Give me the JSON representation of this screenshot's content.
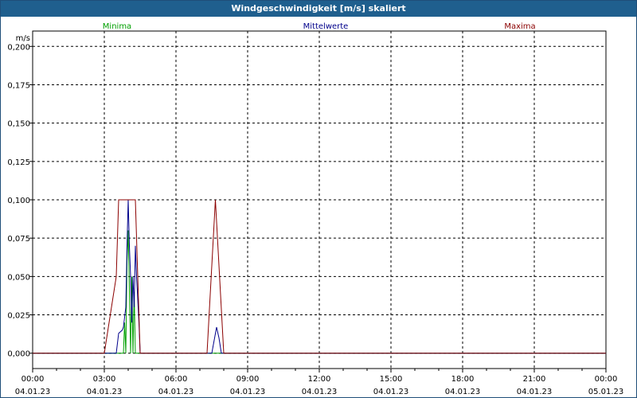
{
  "window": {
    "title": "Windgeschwindigkeit [m/s] skaliert"
  },
  "chart_data": {
    "type": "line",
    "title": "Windgeschwindigkeit [m/s] skaliert",
    "ylabel": "m/s",
    "xlabel": "",
    "ylim": [
      -0.01,
      0.21
    ],
    "xlim": [
      0,
      24
    ],
    "y_ticks": [
      0.0,
      0.025,
      0.05,
      0.075,
      0.1,
      0.125,
      0.15,
      0.175,
      0.2
    ],
    "y_tick_labels": [
      "0,000",
      "0,025",
      "0,050",
      "0,075",
      "0,100",
      "0,125",
      "0,150",
      "0,175",
      "0,200"
    ],
    "x_ticks": [
      0,
      3,
      6,
      9,
      12,
      15,
      18,
      21,
      24
    ],
    "x_tick_labels": [
      {
        "time": "00:00",
        "date": "04.01.23"
      },
      {
        "time": "03:00",
        "date": "04.01.23"
      },
      {
        "time": "06:00",
        "date": "04.01.23"
      },
      {
        "time": "09:00",
        "date": "04.01.23"
      },
      {
        "time": "12:00",
        "date": "04.01.23"
      },
      {
        "time": "15:00",
        "date": "04.01.23"
      },
      {
        "time": "18:00",
        "date": "04.01.23"
      },
      {
        "time": "21:00",
        "date": "04.01.23"
      },
      {
        "time": "00:00",
        "date": "05.01.23"
      }
    ],
    "grid": true,
    "legend_placement": "top",
    "series": [
      {
        "name": "Minima",
        "color": "#00a000",
        "points": [
          [
            0,
            0
          ],
          [
            3.5,
            0
          ],
          [
            3.8,
            0
          ],
          [
            3.85,
            0.02
          ],
          [
            3.9,
            0
          ],
          [
            3.95,
            0.06
          ],
          [
            4.0,
            0.08
          ],
          [
            4.05,
            0.04
          ],
          [
            4.1,
            0
          ],
          [
            4.15,
            0.05
          ],
          [
            4.2,
            0
          ],
          [
            4.25,
            0.04
          ],
          [
            4.3,
            0
          ],
          [
            4.5,
            0
          ],
          [
            24,
            0
          ]
        ]
      },
      {
        "name": "Mittelwerte",
        "color": "#00008b",
        "points": [
          [
            0,
            0
          ],
          [
            3.5,
            0
          ],
          [
            3.6,
            0.013
          ],
          [
            3.75,
            0.015
          ],
          [
            3.8,
            0.017
          ],
          [
            3.9,
            0.03
          ],
          [
            3.95,
            0.07
          ],
          [
            4.0,
            0.1
          ],
          [
            4.05,
            0.07
          ],
          [
            4.1,
            0.05
          ],
          [
            4.15,
            0.02
          ],
          [
            4.2,
            0.05
          ],
          [
            4.25,
            0.03
          ],
          [
            4.3,
            0.07
          ],
          [
            4.35,
            0.05
          ],
          [
            4.45,
            0.02
          ],
          [
            4.5,
            0
          ],
          [
            7.5,
            0
          ],
          [
            7.7,
            0.017
          ],
          [
            7.8,
            0.01
          ],
          [
            7.9,
            0
          ],
          [
            24,
            0
          ]
        ]
      },
      {
        "name": "Maxima",
        "color": "#8b0000",
        "points": [
          [
            0,
            0
          ],
          [
            3.0,
            0
          ],
          [
            3.5,
            0.05
          ],
          [
            3.6,
            0.1
          ],
          [
            4.3,
            0.1
          ],
          [
            4.4,
            0.05
          ],
          [
            4.5,
            0
          ],
          [
            7.3,
            0
          ],
          [
            7.65,
            0.1
          ],
          [
            8.0,
            0
          ],
          [
            24,
            0
          ]
        ]
      }
    ]
  }
}
